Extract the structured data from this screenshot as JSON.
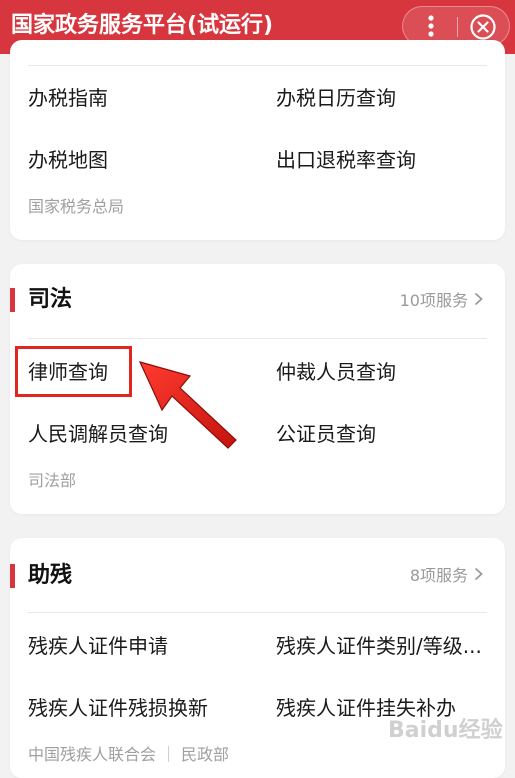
{
  "header": {
    "title": "国家政务服务平台(试运行)"
  },
  "tax_card": {
    "items": [
      "办税指南",
      "办税日历查询",
      "办税地图",
      "出口退税率查询"
    ],
    "source": "国家税务总局"
  },
  "judicial_card": {
    "title": "司法",
    "count": "10项服务",
    "items": [
      "律师查询",
      "仲裁人员查询",
      "人民调解员查询",
      "公证员查询"
    ],
    "source": "司法部"
  },
  "disability_card": {
    "title": "助残",
    "count": "8项服务",
    "items": [
      "残疾人证件申请",
      "残疾人证件类别/等级...",
      "残疾人证件残损换新",
      "残疾人证件挂失补办"
    ],
    "sources": [
      "中国残疾人联合会",
      "民政部"
    ]
  },
  "watermark": "Baidu经验",
  "colors": {
    "header_bg": "#d8363e",
    "accent": "#d8363e",
    "highlight": "#e2251f"
  }
}
